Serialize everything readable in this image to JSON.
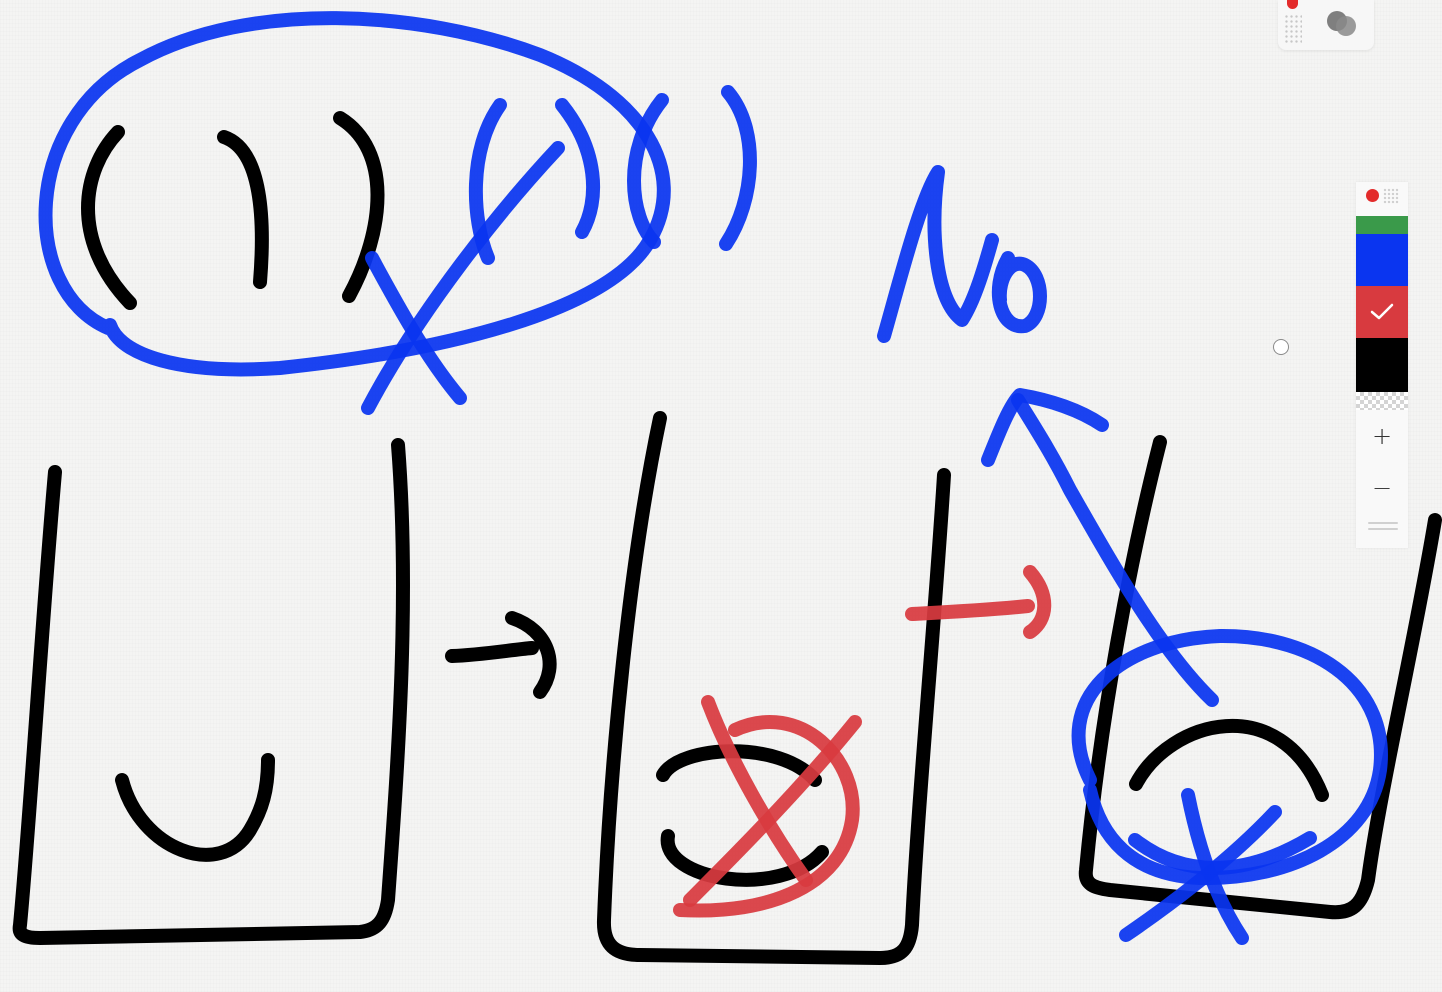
{
  "palette": {
    "swatches": [
      {
        "name": "green",
        "color": "#3a9a4a"
      },
      {
        "name": "blue",
        "color": "#0a35f0"
      },
      {
        "name": "red",
        "color": "#d83a3f",
        "selected": true
      },
      {
        "name": "black",
        "color": "#000000"
      },
      {
        "name": "transparent",
        "color": "transparent"
      }
    ],
    "zoom_in_label": "+",
    "zoom_out_label": "−"
  },
  "tool_widget": {
    "icons": [
      "red-dot-icon",
      "dot-grid-icon",
      "blend-mode-icon"
    ]
  },
  "handwriting": {
    "no_text": "No"
  }
}
